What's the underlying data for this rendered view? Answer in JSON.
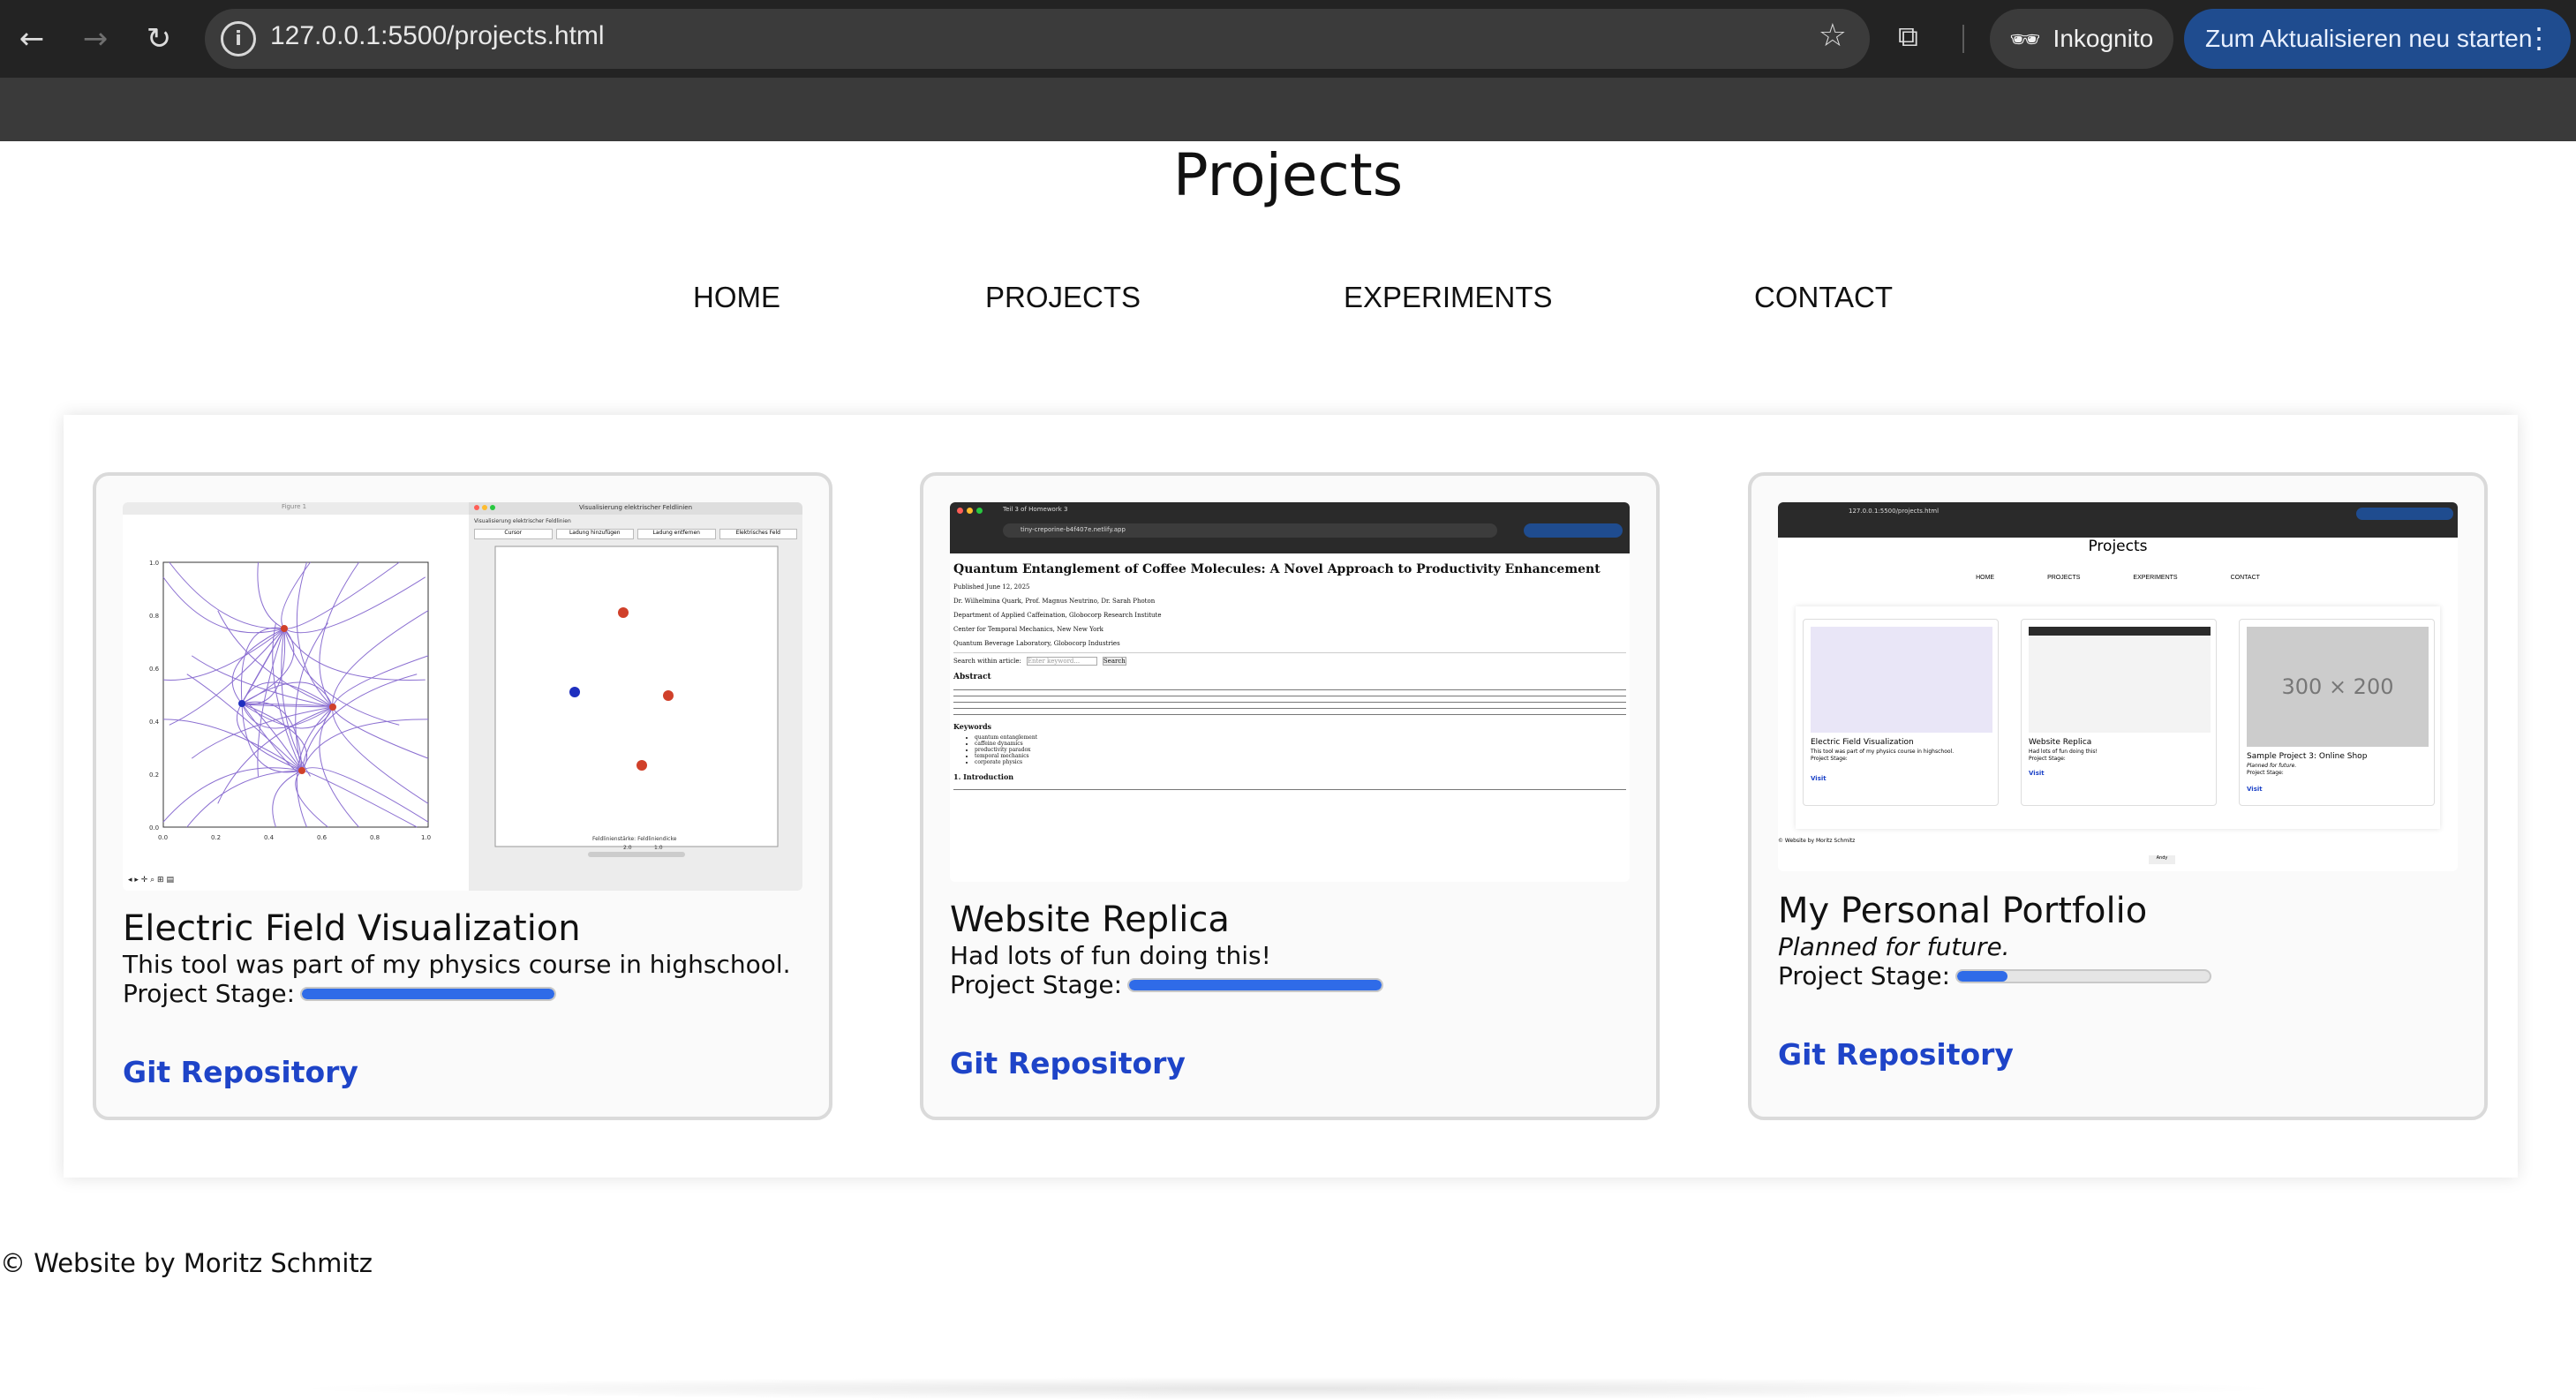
{
  "browser": {
    "url": "127.0.0.1:5500/projects.html",
    "incognito_label": "Inkognito",
    "restart_label": "Zum Aktualisieren neu starten",
    "icons": [
      "back-icon",
      "forward-icon",
      "reload-icon",
      "site-info-icon",
      "bookmark-star-icon",
      "tab-search-icon",
      "incognito-icon",
      "more-menu-icon"
    ]
  },
  "page": {
    "title": "Projects",
    "nav": [
      "HOME",
      "PROJECTS",
      "EXPERIMENTS",
      "CONTACT"
    ],
    "footer": "© Website by Moritz Schmitz"
  },
  "cards": [
    {
      "title": "Electric Field Visualization",
      "description": "This tool was part of my physics course in highschool.",
      "stage_label": "Project Stage:",
      "stage_progress": 1.0,
      "link": "Git Repository"
    },
    {
      "title": "Website Replica",
      "description": "Had lots of fun doing this!",
      "stage_label": "Project Stage:",
      "stage_progress": 1.0,
      "link": "Git Repository"
    },
    {
      "title": "My Personal Portfolio",
      "description": "Planned for future.",
      "stage_label": "Project Stage:",
      "stage_progress": 0.2,
      "link": "Git Repository"
    }
  ],
  "thumb1": {
    "window_title": "Figure 1",
    "app_title": "Visualisierung elektrischer Feldlinien",
    "subtitle": "Visualisierung elektrischer Feldlinien",
    "buttons": [
      "Cursor",
      "Ladung hinzufügen",
      "Ladung entfernen",
      "Elektrisches Feld"
    ],
    "sliders": "Feldlinienstärke: Feldliniendicke",
    "slider_values": [
      "2.0",
      "1.0"
    ],
    "y_ticks": [
      "1.0",
      "0.8",
      "0.6",
      "0.4",
      "0.2",
      "0.0"
    ],
    "x_ticks": [
      "0.0",
      "0.2",
      "0.4",
      "0.6",
      "0.8",
      "1.0"
    ],
    "colors": {
      "positive": "#d0402a",
      "negative": "#1e2fbf",
      "field_lines": "#8b6fd1"
    }
  },
  "thumb2": {
    "tab": "Teil 3 of Homework 3",
    "url": "tiny-creporine-b4f407e.netlify.app",
    "paper_title": "Quantum Entanglement of Coffee Molecules: A Novel Approach to Productivity Enhancement",
    "published": "Published June 12, 2025",
    "authors": "Dr. Wilhelmina Quark, Prof. Magnus Neutrino, Dr. Sarah Photon",
    "affiliations": [
      "Department of Applied Caffeination, Globocorp Research Institute",
      "Center for Temporal Mechanics, New New York",
      "Quantum Beverage Laboratory, Globocorp Industries"
    ],
    "search_label": "Search within article:",
    "search_placeholder": "Enter keyword...",
    "search_button": "Search",
    "abstract_heading": "Abstract",
    "keywords_heading": "Keywords",
    "keywords": [
      "quantum entanglement",
      "caffeine dynamics",
      "productivity paradox",
      "temporal mechanics",
      "corporate physics"
    ],
    "intro_heading": "1. Introduction"
  },
  "thumb3": {
    "url": "127.0.0.1:5500/projects.html",
    "title": "Projects",
    "nav": [
      "HOME",
      "PROJECTS",
      "EXPERIMENTS",
      "CONTACT"
    ],
    "placeholder": "300 × 200",
    "cards": [
      "Electric Field Visualization",
      "Website Replica",
      "Sample Project 3: Online Shop"
    ],
    "descs": [
      "This tool was part of my physics course in highschool.",
      "Had lots of fun doing this!",
      "Planned for future."
    ],
    "stage": "Project Stage:",
    "visit": "Visit",
    "footer": "© Website by Moritz Schmitz",
    "button": "Andy"
  }
}
